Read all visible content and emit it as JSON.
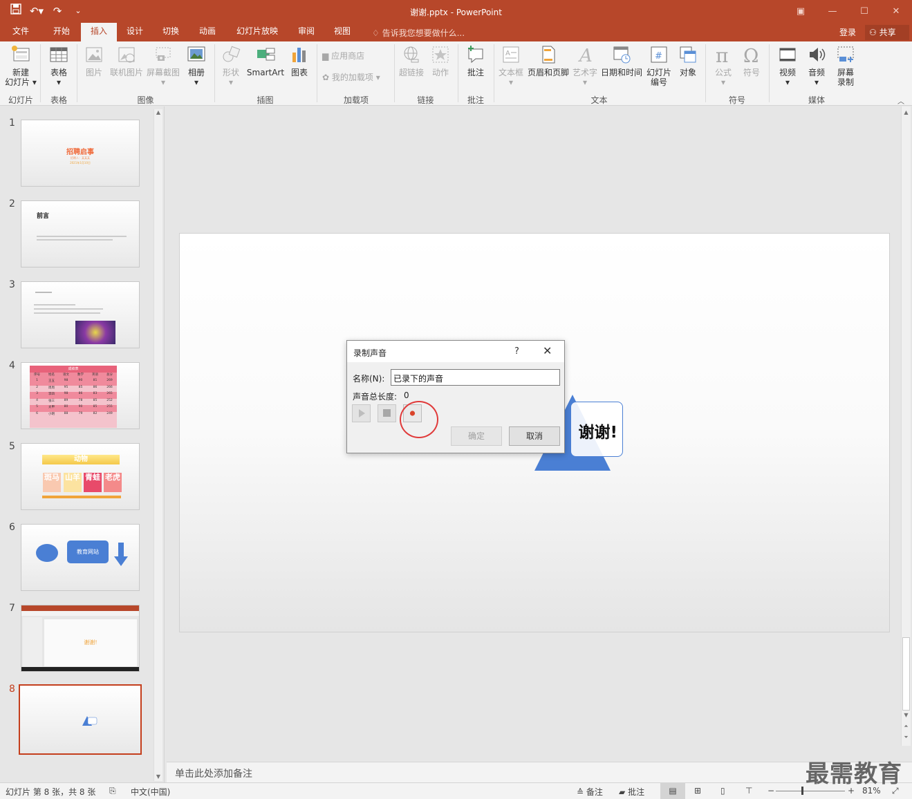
{
  "window": {
    "title": "谢谢.pptx - PowerPoint",
    "qat": [
      "save",
      "undo",
      "redo",
      "customize"
    ]
  },
  "tabs": [
    "文件",
    "开始",
    "插入",
    "设计",
    "切换",
    "动画",
    "幻灯片放映",
    "审阅",
    "视图"
  ],
  "active_tab": "插入",
  "tellme": "告诉我您想要做什么...",
  "login": "登录",
  "share": "共享",
  "ribbon": {
    "new_slide": [
      "新建",
      "幻灯片"
    ],
    "table": "表格",
    "picture": "图片",
    "online_picture": "联机图片",
    "screenshot": "屏幕截图",
    "album": "相册",
    "shapes": "形状",
    "smartart": "SmartArt",
    "chart": "图表",
    "store": "应用商店",
    "my_addins": "我的加载项",
    "hyperlink": "超链接",
    "action": "动作",
    "comment": "批注",
    "textbox": "文本框",
    "header_footer": "页眉和页脚",
    "wordart": "艺术字",
    "datetime": "日期和时间",
    "slide_number": [
      "幻灯片",
      "编号"
    ],
    "object": "对象",
    "equation": "公式",
    "symbol": "符号",
    "video": "视频",
    "audio": "音频",
    "screen_recording": [
      "屏幕",
      "录制"
    ],
    "groups": [
      "幻灯片",
      "表格",
      "图像",
      "插图",
      "加载项",
      "链接",
      "批注",
      "文本",
      "符号",
      "媒体"
    ]
  },
  "slides": {
    "numbers": [
      "1",
      "2",
      "3",
      "4",
      "5",
      "6",
      "7",
      "8"
    ],
    "s1": {
      "title": "招聘启事",
      "sub1": "招聘人：某某某",
      "sub2": "2021年1月10日"
    },
    "s2": {
      "title": "前言"
    },
    "s4": {
      "title": "成绩表",
      "headers": [
        "序号",
        "姓名",
        "语文",
        "数学",
        "英语",
        "总分"
      ],
      "rows": [
        [
          "1",
          "王五",
          "98",
          "90",
          "81",
          "269"
        ],
        [
          "2",
          "周周",
          "95",
          "85",
          "86",
          "266"
        ],
        [
          "3",
          "李四",
          "98",
          "86",
          "83",
          "265"
        ],
        [
          "4",
          "张三",
          "89",
          "78",
          "85",
          "252"
        ],
        [
          "5",
          "太甲",
          "80",
          "90",
          "85",
          "255"
        ],
        [
          "6",
          "小明",
          "88",
          "79",
          "82",
          "249"
        ]
      ]
    },
    "s5": {
      "title": "动物",
      "tiles": [
        "斑马",
        "山羊",
        "青蛙",
        "老虎"
      ]
    },
    "s6": {
      "label": "教育网站"
    },
    "s7": {
      "text": "谢谢!"
    },
    "active": "8"
  },
  "slide_text": "谢谢!",
  "dialog": {
    "title": "录制声音",
    "help": "?",
    "close": "✕",
    "name_label": "名称(N):",
    "name_value": "已录下的声音",
    "length_label": "声音总长度:",
    "length_value": "0",
    "ok": "确定",
    "cancel": "取消"
  },
  "notes_placeholder": "单击此处添加备注",
  "status": {
    "slide_info": "幻灯片 第 8 张，共 8 张",
    "language": "中文(中国)",
    "notes": "备注",
    "comments": "批注",
    "zoom": "81%"
  },
  "watermark": "最需教育",
  "colors": {
    "accent": "#b7472a",
    "record": "#d9442b",
    "slide_shape": "#4a7fd4"
  }
}
